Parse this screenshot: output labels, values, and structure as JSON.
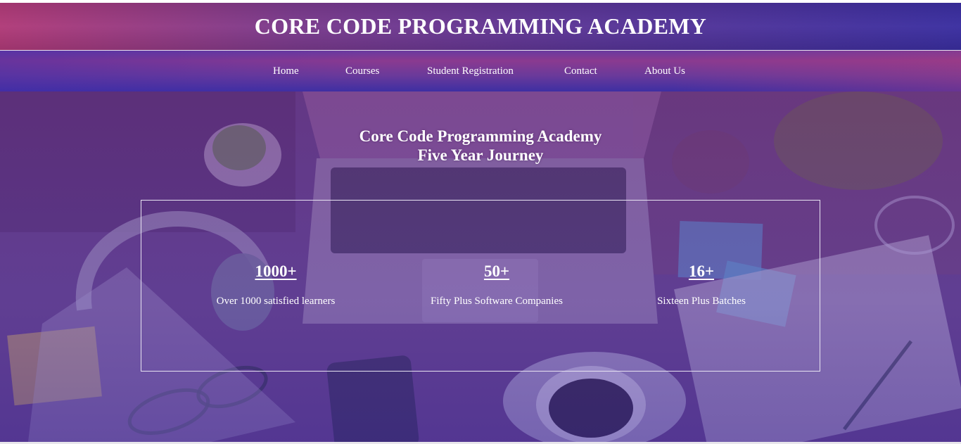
{
  "header": {
    "title": "CORE CODE PROGRAMMING ACADEMY"
  },
  "nav": {
    "items": [
      {
        "label": "Home"
      },
      {
        "label": "Courses"
      },
      {
        "label": "Student Registration"
      },
      {
        "label": "Contact"
      },
      {
        "label": "About Us"
      }
    ]
  },
  "hero": {
    "heading_line1": "Core Code Programming Academy",
    "heading_line2": "Five Year Journey",
    "stats": [
      {
        "value": "1000+",
        "label": "Over 1000 satisfied learners"
      },
      {
        "value": "50+",
        "label": "Fifty Plus Software Companies"
      },
      {
        "value": "16+",
        "label": "Sixteen Plus Batches"
      }
    ]
  },
  "colors": {
    "header_gradient_start": "#b03a78",
    "header_gradient_end": "#3a2ea0",
    "hero_overlay": "#6a4a9e",
    "text": "#ffffff"
  }
}
